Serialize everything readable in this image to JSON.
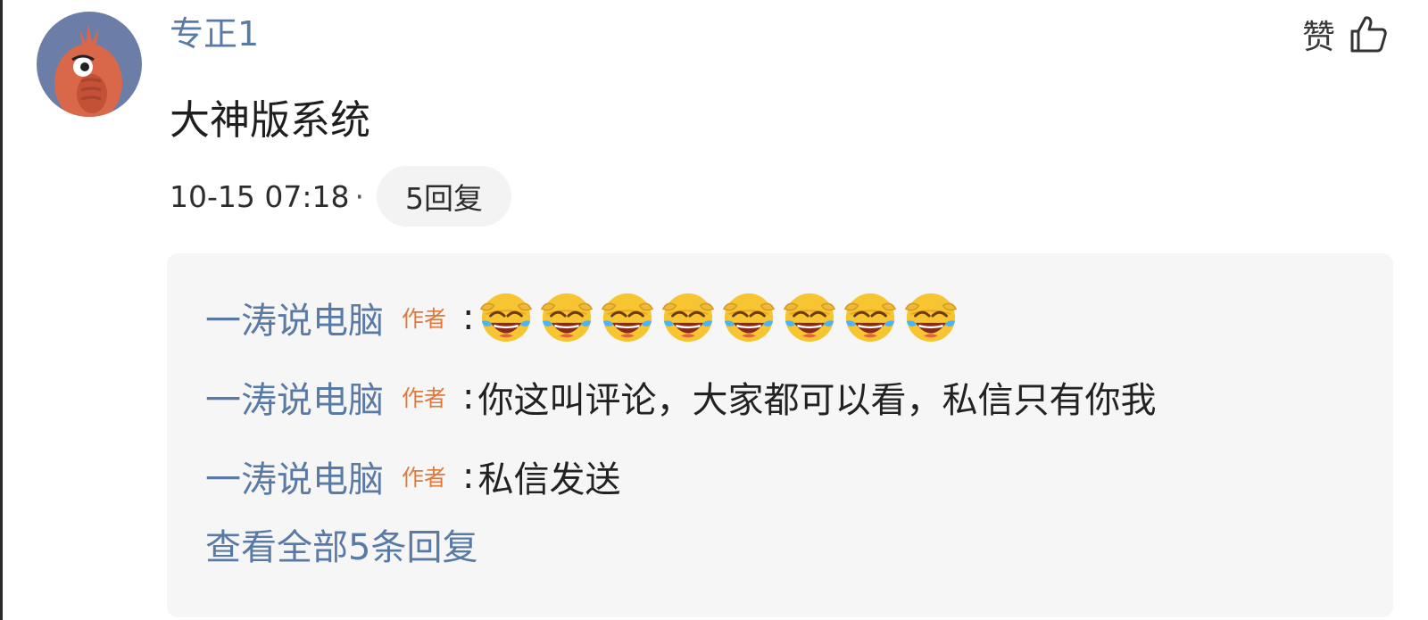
{
  "comment": {
    "username": "专正1",
    "text": "大神版系统",
    "timestamp": "10-15 07:18",
    "separator": "·",
    "reply_count_label": "5回复",
    "like_label": "赞",
    "avatar_icon": "avatar-cartoon-creature-icon",
    "like_icon": "thumbs-up-icon"
  },
  "replies": [
    {
      "author": "一涛说电脑",
      "badge": "作者",
      "colon": ":",
      "text": "",
      "emoji": {
        "name": "laughing-crying-emoji",
        "count": 8
      }
    },
    {
      "author": "一涛说电脑",
      "badge": "作者",
      "colon": ":",
      "text": "你这叫评论，大家都可以看，私信只有你我"
    },
    {
      "author": "一涛说电脑",
      "badge": "作者",
      "colon": ":",
      "text": "私信发送"
    }
  ],
  "view_all_label": "查看全部5条回复",
  "colors": {
    "link_blue": "#5a7aa6",
    "badge_orange": "#e0793b",
    "reply_bg": "#f6f6f6",
    "avatar_bg": "#6c7ea8"
  }
}
